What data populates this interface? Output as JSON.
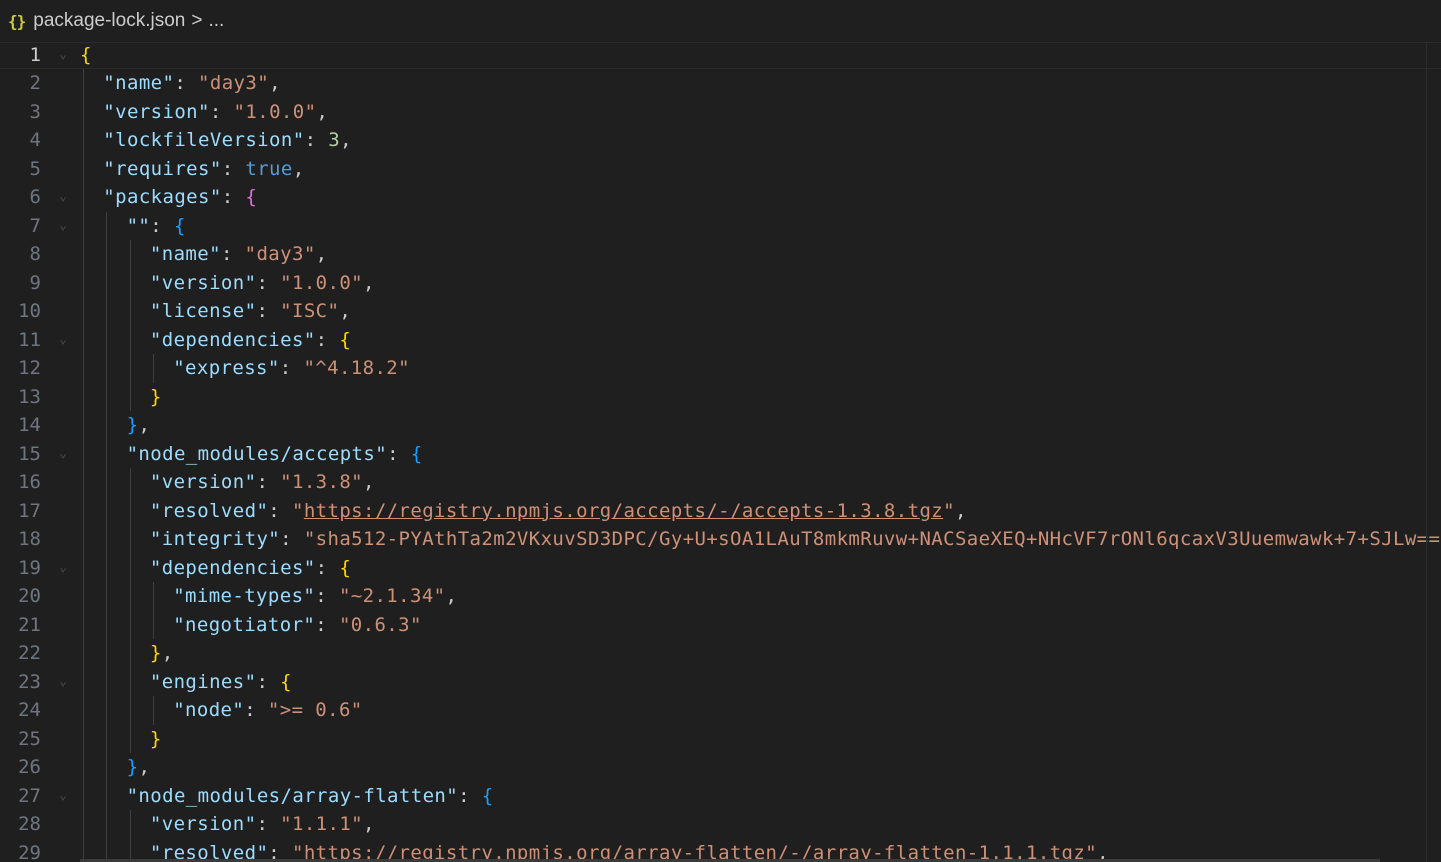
{
  "breadcrumb": {
    "icon": "json-braces-icon",
    "icon_glyph": "{}",
    "file": "package-lock.json",
    "separator": ">",
    "ellipsis": "..."
  },
  "editor": {
    "current_line": 1,
    "lines": [
      [
        [
          "br1",
          "{"
        ]
      ],
      [
        [
          "k",
          "\"name\""
        ],
        [
          "p",
          ": "
        ],
        [
          "s",
          "\"day3\""
        ],
        [
          "p",
          ","
        ]
      ],
      [
        [
          "k",
          "\"version\""
        ],
        [
          "p",
          ": "
        ],
        [
          "s",
          "\"1.0.0\""
        ],
        [
          "p",
          ","
        ]
      ],
      [
        [
          "k",
          "\"lockfileVersion\""
        ],
        [
          "p",
          ": "
        ],
        [
          "n",
          "3"
        ],
        [
          "p",
          ","
        ]
      ],
      [
        [
          "k",
          "\"requires\""
        ],
        [
          "p",
          ": "
        ],
        [
          "b",
          "true"
        ],
        [
          "p",
          ","
        ]
      ],
      [
        [
          "k",
          "\"packages\""
        ],
        [
          "p",
          ": "
        ],
        [
          "br2",
          "{"
        ]
      ],
      [
        [
          "k",
          "\"\""
        ],
        [
          "p",
          ": "
        ],
        [
          "br3",
          "{"
        ]
      ],
      [
        [
          "k",
          "\"name\""
        ],
        [
          "p",
          ": "
        ],
        [
          "s",
          "\"day3\""
        ],
        [
          "p",
          ","
        ]
      ],
      [
        [
          "k",
          "\"version\""
        ],
        [
          "p",
          ": "
        ],
        [
          "s",
          "\"1.0.0\""
        ],
        [
          "p",
          ","
        ]
      ],
      [
        [
          "k",
          "\"license\""
        ],
        [
          "p",
          ": "
        ],
        [
          "s",
          "\"ISC\""
        ],
        [
          "p",
          ","
        ]
      ],
      [
        [
          "k",
          "\"dependencies\""
        ],
        [
          "p",
          ": "
        ],
        [
          "br1",
          "{"
        ]
      ],
      [
        [
          "k",
          "\"express\""
        ],
        [
          "p",
          ": "
        ],
        [
          "s",
          "\"^4.18.2\""
        ]
      ],
      [
        [
          "br1",
          "}"
        ]
      ],
      [
        [
          "br3",
          "}"
        ],
        [
          "p",
          ","
        ]
      ],
      [
        [
          "k",
          "\"node_modules/accepts\""
        ],
        [
          "p",
          ": "
        ],
        [
          "br3",
          "{"
        ]
      ],
      [
        [
          "k",
          "\"version\""
        ],
        [
          "p",
          ": "
        ],
        [
          "s",
          "\"1.3.8\""
        ],
        [
          "p",
          ","
        ]
      ],
      [
        [
          "k",
          "\"resolved\""
        ],
        [
          "p",
          ": "
        ],
        [
          "s",
          "\""
        ],
        [
          "u",
          "https://registry.npmjs.org/accepts/-/accepts-1.3.8.tgz"
        ],
        [
          "s",
          "\""
        ],
        [
          "p",
          ","
        ]
      ],
      [
        [
          "k",
          "\"integrity\""
        ],
        [
          "p",
          ": "
        ],
        [
          "s",
          "\"sha512-PYAthTa2m2VKxuvSD3DPC/Gy+U+sOA1LAuT8mkmRuvw+NACSaeXEQ+NHcVF7rONl6qcaxV3Uuemwawk+7+SJLw==\""
        ],
        [
          "p",
          ","
        ]
      ],
      [
        [
          "k",
          "\"dependencies\""
        ],
        [
          "p",
          ": "
        ],
        [
          "br1",
          "{"
        ]
      ],
      [
        [
          "k",
          "\"mime-types\""
        ],
        [
          "p",
          ": "
        ],
        [
          "s",
          "\"~2.1.34\""
        ],
        [
          "p",
          ","
        ]
      ],
      [
        [
          "k",
          "\"negotiator\""
        ],
        [
          "p",
          ": "
        ],
        [
          "s",
          "\"0.6.3\""
        ]
      ],
      [
        [
          "br1",
          "}"
        ],
        [
          "p",
          ","
        ]
      ],
      [
        [
          "k",
          "\"engines\""
        ],
        [
          "p",
          ": "
        ],
        [
          "br1",
          "{"
        ]
      ],
      [
        [
          "k",
          "\"node\""
        ],
        [
          "p",
          ": "
        ],
        [
          "s",
          "\">= 0.6\""
        ]
      ],
      [
        [
          "br1",
          "}"
        ]
      ],
      [
        [
          "br3",
          "}"
        ],
        [
          "p",
          ","
        ]
      ],
      [
        [
          "k",
          "\"node_modules/array-flatten\""
        ],
        [
          "p",
          ": "
        ],
        [
          "br3",
          "{"
        ]
      ],
      [
        [
          "k",
          "\"version\""
        ],
        [
          "p",
          ": "
        ],
        [
          "s",
          "\"1.1.1\""
        ],
        [
          "p",
          ","
        ]
      ],
      [
        [
          "k",
          "\"resolved\""
        ],
        [
          "p",
          ": "
        ],
        [
          "s",
          "\""
        ],
        [
          "u",
          "https://registry.npmjs.org/array-flatten/-/array-flatten-1.1.1.tgz"
        ],
        [
          "s",
          "\""
        ],
        [
          "p",
          ","
        ]
      ]
    ]
  }
}
